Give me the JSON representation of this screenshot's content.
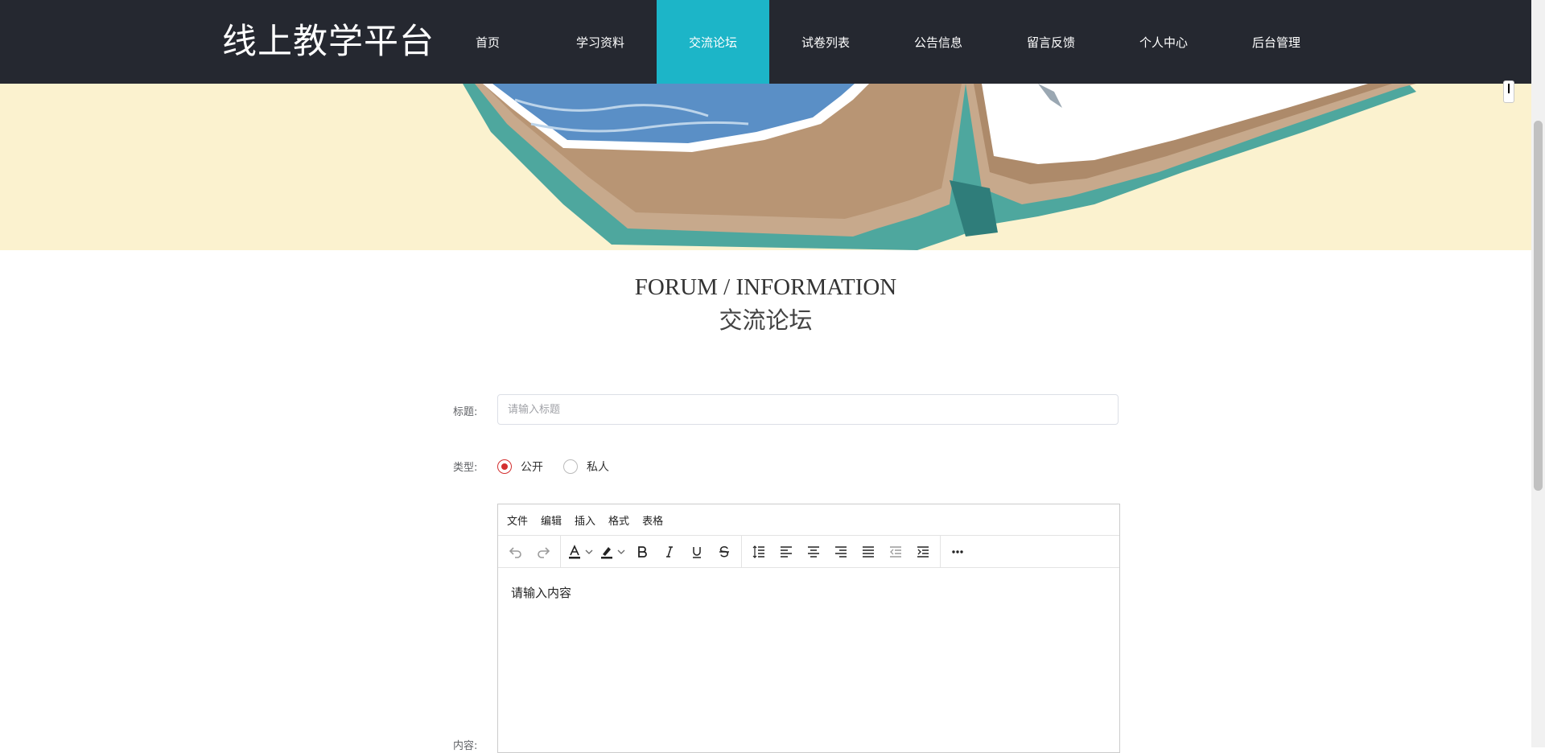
{
  "header": {
    "logo": "线上教学平台",
    "nav": [
      {
        "label": "首页",
        "active": false
      },
      {
        "label": "学习资料",
        "active": false
      },
      {
        "label": "交流论坛",
        "active": true
      },
      {
        "label": "试卷列表",
        "active": false
      },
      {
        "label": "公告信息",
        "active": false
      },
      {
        "label": "留言反馈",
        "active": false
      },
      {
        "label": "个人中心",
        "active": false
      },
      {
        "label": "后台管理",
        "active": false
      }
    ]
  },
  "page": {
    "title_en": "FORUM / INFORMATION",
    "title_cn": "交流论坛"
  },
  "form": {
    "title_label": "标题:",
    "title_placeholder": "请输入标题",
    "title_value": "",
    "type_label": "类型:",
    "type_options": [
      "公开",
      "私人"
    ],
    "type_selected": "公开",
    "content_label": "内容:"
  },
  "editor": {
    "menu": [
      "文件",
      "编辑",
      "插入",
      "格式",
      "表格"
    ],
    "toolbar_icons": [
      "undo-icon",
      "redo-icon",
      "text-color-icon",
      "highlight-icon",
      "bold-icon",
      "italic-icon",
      "underline-icon",
      "strikethrough-icon",
      "line-height-icon",
      "align-left-icon",
      "align-center-icon",
      "align-right-icon",
      "align-justify-icon",
      "outdent-icon",
      "indent-icon",
      "more-icon"
    ],
    "placeholder": "请输入内容"
  },
  "colors": {
    "nav_bg": "#252830",
    "nav_active": "#1cb5c8",
    "banner_bg": "#fbf2cf",
    "radio_checked": "#d32f2f"
  }
}
